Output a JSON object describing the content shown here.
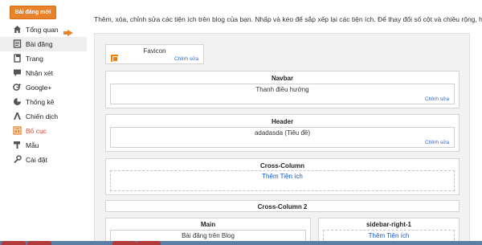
{
  "new_post_label": "Bài đăng mới",
  "sidebar": {
    "items": [
      {
        "label": "Tổng quan",
        "icon": "home-icon"
      },
      {
        "label": "Bài đăng",
        "icon": "posts-icon"
      },
      {
        "label": "Trang",
        "icon": "pages-icon"
      },
      {
        "label": "Nhận xét",
        "icon": "comments-icon"
      },
      {
        "label": "Google+",
        "icon": "google-plus-icon"
      },
      {
        "label": "Thống kê",
        "icon": "stats-icon"
      },
      {
        "label": "Chiến dịch",
        "icon": "campaign-icon"
      },
      {
        "label": "Bố cục",
        "icon": "layout-icon"
      },
      {
        "label": "Mẫu",
        "icon": "template-icon"
      },
      {
        "label": "Cài đặt",
        "icon": "settings-icon"
      }
    ],
    "active_color": "#dd4b39"
  },
  "description": "Thêm, xóa, chỉnh sửa các tiện ích trên blog của bạn. Nhấp và kéo để sắp xếp lại các tiện ích. Để thay đổi số cột và chiều rộng, hãy sử dụng",
  "layout": {
    "favicon": {
      "title": "Favicon",
      "edit": "Chỉnh sửa"
    },
    "navbar": {
      "section": "Navbar",
      "title": "Thanh điều hướng",
      "edit": "Chỉnh sửa"
    },
    "header": {
      "section": "Header",
      "title": "adadasda (Tiêu đề)",
      "edit": "Chỉnh sửa"
    },
    "cross_column": {
      "section": "Cross-Column",
      "add": "Thêm Tiện ích"
    },
    "cross_column_2": {
      "section": "Cross-Column 2"
    },
    "main": {
      "section": "Main",
      "title": "Bài đăng trên Blog"
    },
    "sidebar_right": {
      "section": "sidebar-right-1",
      "add": "Thêm Tiện ích"
    }
  },
  "colors": {
    "accent": "#e8822b",
    "link": "#3366cc"
  }
}
